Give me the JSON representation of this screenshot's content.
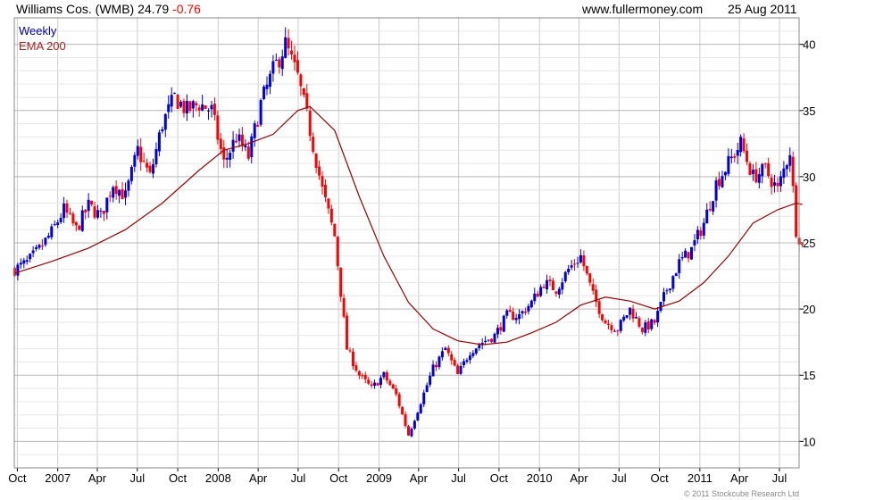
{
  "header": {
    "name": "Williams Cos. (WMB)",
    "price": "24.79",
    "change": "-0.76",
    "website": "www.fullermoney.com",
    "date": "25 Aug 2011"
  },
  "copyright": "© 2011 Stockcube Research Ltd",
  "colors": {
    "up": "#0000dd",
    "down": "#ff0000",
    "ema": "#990000",
    "grid": "#cccccc",
    "frame": "#888888"
  },
  "chart_data": {
    "type": "candlestick",
    "title": "Williams Cos. (WMB) 24.79 -0.76",
    "interval_label": "Weekly",
    "ema_label": "EMA 200",
    "y_ticks": [
      10,
      15,
      20,
      25,
      30,
      35,
      40
    ],
    "ylim": [
      8,
      42
    ],
    "x_tick_labels": [
      "Oct",
      "2007",
      "Apr",
      "Jul",
      "Oct",
      "2008",
      "Apr",
      "Jul",
      "Oct",
      "2009",
      "Apr",
      "Jul",
      "Oct",
      "2010",
      "Apr",
      "Jul",
      "Oct",
      "2011",
      "Apr",
      "Jul"
    ],
    "grid": true,
    "weekly_close_path": [
      [
        "2006-09-25",
        23.0
      ],
      [
        "2006-10-23",
        23.5
      ],
      [
        "2006-11-20",
        24.5
      ],
      [
        "2006-12-18",
        25.8
      ],
      [
        "2007-01-15",
        27.5
      ],
      [
        "2007-02-12",
        26.0
      ],
      [
        "2007-03-12",
        27.8
      ],
      [
        "2007-04-09",
        27.0
      ],
      [
        "2007-05-07",
        29.5
      ],
      [
        "2007-06-04",
        28.5
      ],
      [
        "2007-07-02",
        32.0
      ],
      [
        "2007-07-30",
        30.0
      ],
      [
        "2007-08-27",
        34.0
      ],
      [
        "2007-09-24",
        36.0
      ],
      [
        "2007-10-22",
        35.0
      ],
      [
        "2007-11-19",
        35.5
      ],
      [
        "2007-12-17",
        35.0
      ],
      [
        "2008-01-14",
        31.0
      ],
      [
        "2008-02-11",
        33.0
      ],
      [
        "2008-03-10",
        31.5
      ],
      [
        "2008-04-07",
        35.5
      ],
      [
        "2008-05-05",
        38.0
      ],
      [
        "2008-06-02",
        40.0
      ],
      [
        "2008-06-30",
        37.5
      ],
      [
        "2008-07-28",
        33.5
      ],
      [
        "2008-08-25",
        29.0
      ],
      [
        "2008-09-22",
        25.5
      ],
      [
        "2008-10-20",
        17.0
      ],
      [
        "2008-11-17",
        15.0
      ],
      [
        "2008-12-15",
        14.0
      ],
      [
        "2009-01-12",
        15.0
      ],
      [
        "2009-02-09",
        13.5
      ],
      [
        "2009-03-09",
        10.5
      ],
      [
        "2009-04-06",
        13.0
      ],
      [
        "2009-05-04",
        15.5
      ],
      [
        "2009-06-01",
        17.0
      ],
      [
        "2009-06-29",
        15.0
      ],
      [
        "2009-07-27",
        16.8
      ],
      [
        "2009-08-24",
        17.5
      ],
      [
        "2009-09-21",
        18.0
      ],
      [
        "2009-10-19",
        19.5
      ],
      [
        "2009-11-16",
        19.5
      ],
      [
        "2009-12-14",
        20.5
      ],
      [
        "2010-01-11",
        22.0
      ],
      [
        "2010-02-08",
        21.5
      ],
      [
        "2010-03-08",
        23.0
      ],
      [
        "2010-04-05",
        24.0
      ],
      [
        "2010-05-03",
        21.0
      ],
      [
        "2010-05-31",
        19.0
      ],
      [
        "2010-06-28",
        18.5
      ],
      [
        "2010-07-26",
        20.0
      ],
      [
        "2010-08-23",
        18.5
      ],
      [
        "2010-09-20",
        19.0
      ],
      [
        "2010-10-18",
        21.5
      ],
      [
        "2010-11-15",
        23.5
      ],
      [
        "2010-12-13",
        24.5
      ],
      [
        "2011-01-10",
        26.5
      ],
      [
        "2011-02-07",
        29.5
      ],
      [
        "2011-03-07",
        31.0
      ],
      [
        "2011-04-04",
        32.5
      ],
      [
        "2011-05-02",
        30.0
      ],
      [
        "2011-05-30",
        30.5
      ],
      [
        "2011-06-27",
        29.0
      ],
      [
        "2011-07-25",
        32.0
      ],
      [
        "2011-08-08",
        26.0
      ],
      [
        "2011-08-22",
        24.8
      ]
    ],
    "ema_path": [
      [
        "2006-09-25",
        22.7
      ],
      [
        "2006-12-18",
        23.6
      ],
      [
        "2007-03-12",
        24.6
      ],
      [
        "2007-06-04",
        26.0
      ],
      [
        "2007-08-27",
        28.0
      ],
      [
        "2007-11-19",
        30.5
      ],
      [
        "2008-01-14",
        32.0
      ],
      [
        "2008-03-10",
        32.5
      ],
      [
        "2008-05-05",
        33.2
      ],
      [
        "2008-06-30",
        35.0
      ],
      [
        "2008-07-28",
        35.3
      ],
      [
        "2008-09-22",
        33.5
      ],
      [
        "2008-11-17",
        28.5
      ],
      [
        "2009-01-12",
        24.0
      ],
      [
        "2009-03-09",
        20.5
      ],
      [
        "2009-05-04",
        18.5
      ],
      [
        "2009-06-29",
        17.6
      ],
      [
        "2009-08-24",
        17.3
      ],
      [
        "2009-10-19",
        17.5
      ],
      [
        "2009-12-14",
        18.2
      ],
      [
        "2010-02-08",
        19.0
      ],
      [
        "2010-04-05",
        20.3
      ],
      [
        "2010-05-31",
        20.9
      ],
      [
        "2010-07-26",
        20.6
      ],
      [
        "2010-09-20",
        20.0
      ],
      [
        "2010-11-15",
        20.6
      ],
      [
        "2011-01-10",
        22.0
      ],
      [
        "2011-03-07",
        24.0
      ],
      [
        "2011-05-02",
        26.5
      ],
      [
        "2011-06-27",
        27.5
      ],
      [
        "2011-08-08",
        28.0
      ],
      [
        "2011-08-22",
        27.9
      ]
    ]
  }
}
